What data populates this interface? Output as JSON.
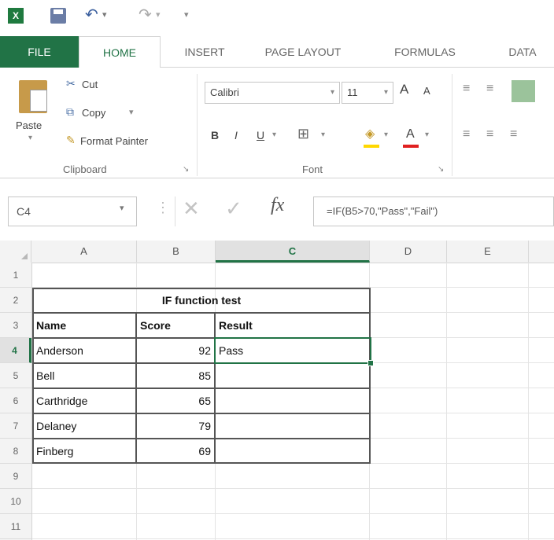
{
  "app": {
    "logo_letter": "X"
  },
  "tabs": [
    {
      "label": "FILE"
    },
    {
      "label": "HOME"
    },
    {
      "label": "INSERT"
    },
    {
      "label": "PAGE LAYOUT"
    },
    {
      "label": "FORMULAS"
    },
    {
      "label": "DATA"
    }
  ],
  "ribbon": {
    "clipboard": {
      "paste": "Paste",
      "cut": "Cut",
      "copy": "Copy",
      "copy_arrow": "▾",
      "format_painter": "Format Painter",
      "group_label": "Clipboard"
    },
    "font": {
      "family": "Calibri",
      "size": "11",
      "bold": "B",
      "italic": "I",
      "underline": "U",
      "grow": "A",
      "shrink": "A",
      "font_color": "A",
      "group_label": "Font"
    }
  },
  "formula_bar": {
    "name_box": "C4",
    "fx": "fx",
    "cancel": "✕",
    "enter": "✓",
    "formula": "=IF(B5>70,\"Pass\",\"Fail\")"
  },
  "grid": {
    "columns": [
      "A",
      "B",
      "C",
      "D",
      "E"
    ],
    "rows": [
      "1",
      "2",
      "3",
      "4",
      "5",
      "6",
      "7",
      "8",
      "9",
      "10",
      "11"
    ],
    "title": "IF function test",
    "headers": [
      "Name",
      "Score",
      "Result"
    ],
    "data": [
      {
        "name": "Anderson",
        "score": "92",
        "result": "Pass"
      },
      {
        "name": "Bell",
        "score": "85",
        "result": ""
      },
      {
        "name": "Carthridge",
        "score": "65",
        "result": ""
      },
      {
        "name": "Delaney",
        "score": "79",
        "result": ""
      },
      {
        "name": "Finberg",
        "score": "69",
        "result": ""
      }
    ]
  },
  "colors": {
    "excel_green": "#217346",
    "font_color_bar": "#e02020",
    "highlight_bar": "#ffd800"
  }
}
